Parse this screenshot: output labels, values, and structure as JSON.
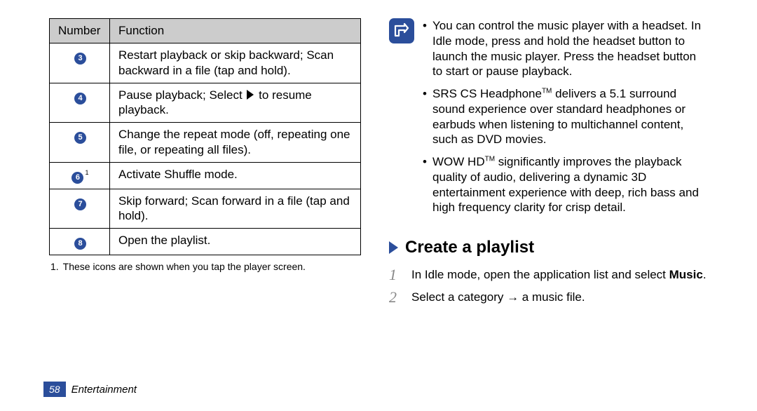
{
  "table": {
    "headers": {
      "number": "Number",
      "function": "Function"
    },
    "rows": [
      {
        "n": "3",
        "sup": "",
        "fn_pre": "Restart playback or skip backward; Scan backward in a file (tap and hold).",
        "fn_icon": "",
        "fn_post": ""
      },
      {
        "n": "4",
        "sup": "",
        "fn_pre": "Pause playback; Select ",
        "fn_icon": "play",
        "fn_post": " to resume playback."
      },
      {
        "n": "5",
        "sup": "",
        "fn_pre": "Change the repeat mode (off, repeating one file, or repeating all files).",
        "fn_icon": "",
        "fn_post": ""
      },
      {
        "n": "6",
        "sup": "1",
        "fn_pre": "Activate Shuffle mode.",
        "fn_icon": "",
        "fn_post": ""
      },
      {
        "n": "7",
        "sup": "",
        "fn_pre": "Skip forward; Scan forward in a file (tap and hold).",
        "fn_icon": "",
        "fn_post": ""
      },
      {
        "n": "8",
        "sup": "",
        "fn_pre": "Open the playlist.",
        "fn_icon": "",
        "fn_post": ""
      }
    ]
  },
  "footnote": {
    "n": "1.",
    "text": "These icons are shown when you tap the player screen."
  },
  "right": {
    "bullets": [
      {
        "pre": "You can control the music player with a headset. In Idle mode, press and hold the headset button to launch the music player. Press the headset button to start or pause playback.",
        "tm": "",
        "post": ""
      },
      {
        "pre": "SRS CS Headphone",
        "tm": "TM",
        "post": " delivers a 5.1 surround sound experience over standard headphones or earbuds when listening to multichannel content, such as DVD movies."
      },
      {
        "pre": "WOW HD",
        "tm": "TM",
        "post": " significantly improves the playback quality of audio, delivering a dynamic 3D entertainment experience with deep, rich bass and high frequency clarity for crisp detail."
      }
    ],
    "section_heading": "Create a playlist",
    "steps": [
      {
        "n": "1",
        "pre": "In Idle mode, open the application list and select ",
        "bold": "Music",
        "post": "."
      },
      {
        "n": "2",
        "pre": "Select a category → a music file.",
        "bold": "",
        "post": ""
      }
    ]
  },
  "footer": {
    "page": "58",
    "section": "Entertainment"
  }
}
